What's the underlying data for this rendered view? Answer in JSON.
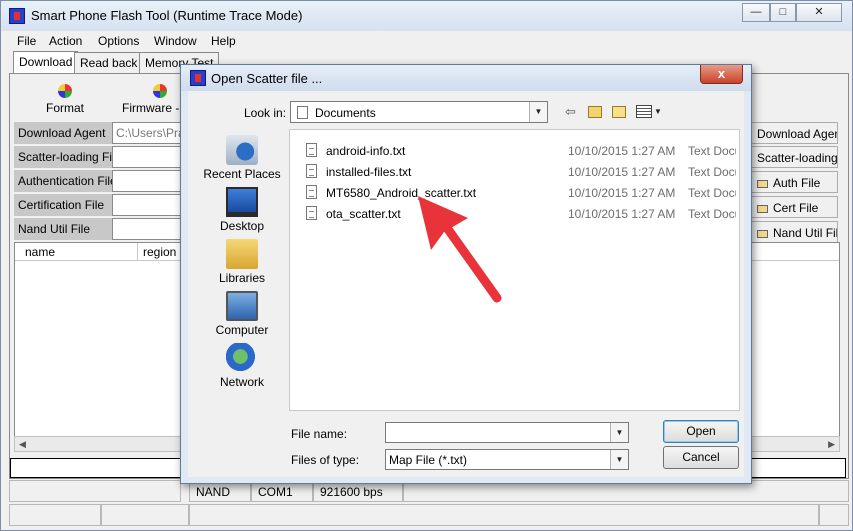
{
  "main_window": {
    "title": "Smart Phone Flash Tool (Runtime Trace Mode)",
    "controls": {
      "minimize": "—",
      "maximize": "□",
      "close": "✕"
    }
  },
  "menu": [
    {
      "label": "File"
    },
    {
      "label": "Action"
    },
    {
      "label": "Options"
    },
    {
      "label": "Window"
    },
    {
      "label": "Help"
    }
  ],
  "tabs": [
    {
      "label": "Download"
    },
    {
      "label": "Read back"
    },
    {
      "label": "Memory Test"
    }
  ],
  "toolbar": {
    "format_label": "Format",
    "firmware_label": "Firmware -> U"
  },
  "fields": [
    {
      "label": "Download Agent",
      "value": "C:\\Users\\Prav"
    },
    {
      "label": "Scatter-loading File",
      "value": ""
    },
    {
      "label": "Authentication File",
      "value": ""
    },
    {
      "label": "Certification File",
      "value": ""
    },
    {
      "label": "Nand Util File",
      "value": ""
    }
  ],
  "right_buttons": [
    {
      "label": "Download Agent"
    },
    {
      "label": "Scatter-loading"
    },
    {
      "label": "Auth File"
    },
    {
      "label": "Cert File"
    },
    {
      "label": "Nand Util File"
    }
  ],
  "list_columns": [
    "name",
    "region a"
  ],
  "status_bar": {
    "storage": "NAND",
    "port": "COM1",
    "baud": "921600 bps"
  },
  "dialog": {
    "title": "Open Scatter file ...",
    "close": "x",
    "look_in_label": "Look in:",
    "look_in_value": "Documents",
    "places": [
      {
        "label": "Recent Places",
        "icon": "recent-places-icon"
      },
      {
        "label": "Desktop",
        "icon": "desktop-icon"
      },
      {
        "label": "Libraries",
        "icon": "libraries-icon"
      },
      {
        "label": "Computer",
        "icon": "computer-icon"
      },
      {
        "label": "Network",
        "icon": "network-icon"
      }
    ],
    "files": [
      {
        "name": "android-info.txt",
        "date": "10/10/2015 1:27 AM",
        "type": "Text Docu"
      },
      {
        "name": "installed-files.txt",
        "date": "10/10/2015 1:27 AM",
        "type": "Text Docu"
      },
      {
        "name": "MT6580_Android_scatter.txt",
        "date": "10/10/2015 1:27 AM",
        "type": "Text Docu"
      },
      {
        "name": "ota_scatter.txt",
        "date": "10/10/2015 1:27 AM",
        "type": "Text Docu"
      }
    ],
    "file_name_label": "File name:",
    "file_name_value": "",
    "file_type_label": "Files of type:",
    "file_type_value": "Map File (*.txt)",
    "open_label": "Open",
    "cancel_label": "Cancel"
  },
  "colors": {
    "arrow": "#e8333a",
    "title_bar": "#d6e2f0",
    "close_button": "#c7432a"
  }
}
